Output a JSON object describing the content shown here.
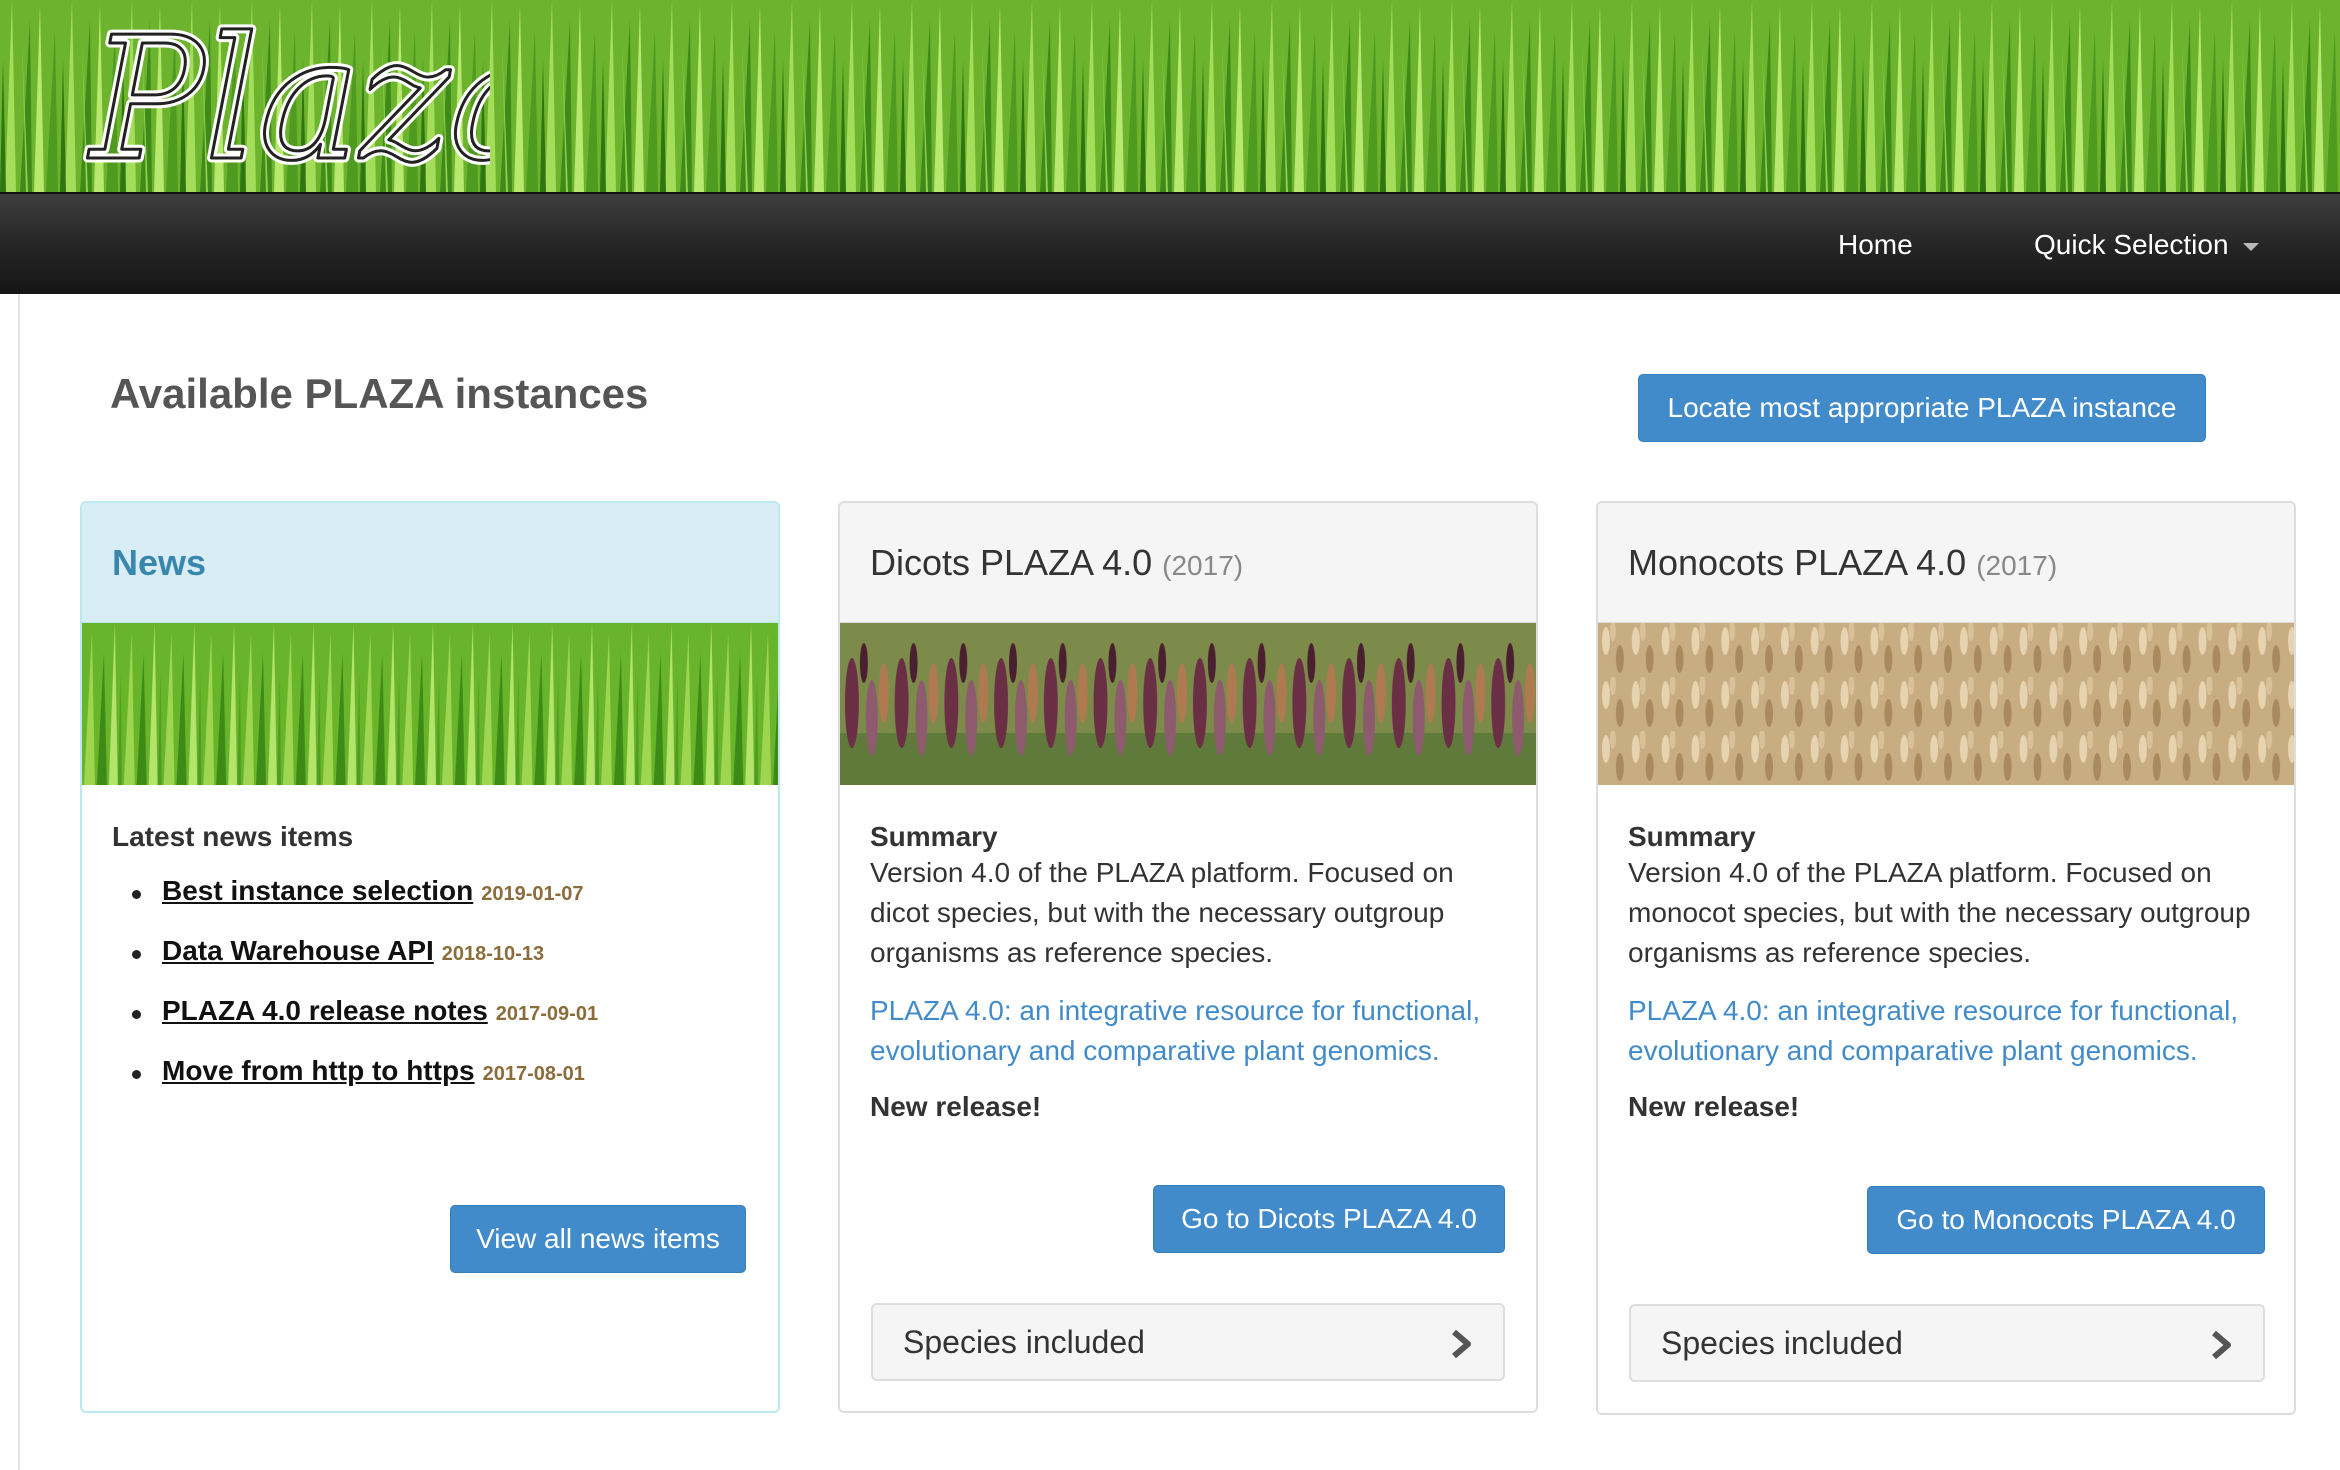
{
  "header": {
    "logo_text": "Plaza",
    "nav": {
      "home": "Home",
      "quick_selection": "Quick Selection"
    }
  },
  "main": {
    "title": "Available PLAZA instances",
    "locate_button": "Locate most appropriate PLAZA instance"
  },
  "news_panel": {
    "heading": "News",
    "latest_label": "Latest news items",
    "items": [
      {
        "title": "Best instance selection",
        "date": "2019-01-07"
      },
      {
        "title": "Data Warehouse API",
        "date": "2018-10-13"
      },
      {
        "title": "PLAZA 4.0 release notes",
        "date": "2017-09-01"
      },
      {
        "title": "Move from http to https",
        "date": "2017-08-01"
      }
    ],
    "view_all_button": "View all news items"
  },
  "dicots_panel": {
    "title": "Dicots PLAZA 4.0",
    "year": "(2017)",
    "summary_label": "Summary",
    "summary_text": "Version 4.0 of the PLAZA platform. Focused on dicot species, but with the necessary outgroup organisms as reference species.",
    "publication_link": "PLAZA 4.0: an integrative resource for functional, evolutionary and comparative plant genomics.",
    "release_note": "New release!",
    "go_button": "Go to Dicots PLAZA 4.0",
    "species_label": "Species included"
  },
  "monocots_panel": {
    "title": "Monocots PLAZA 4.0",
    "year": "(2017)",
    "summary_label": "Summary",
    "summary_text": "Version 4.0 of the PLAZA platform. Focused on monocot species, but with the necessary outgroup organisms as reference species.",
    "publication_link": "PLAZA 4.0: an integrative resource for functional, evolutionary and comparative plant genomics.",
    "release_note": "New release!",
    "go_button": "Go to Monocots PLAZA 4.0",
    "species_label": "Species included"
  },
  "colors": {
    "primary": "#428bca",
    "navbar": "#1f1f1f",
    "news_heading_bg": "#d9edf7",
    "news_heading_text": "#3a87ad",
    "date_text": "#8a6d3b"
  },
  "icons": [
    "caret-down-icon",
    "chevron-right-icon"
  ]
}
